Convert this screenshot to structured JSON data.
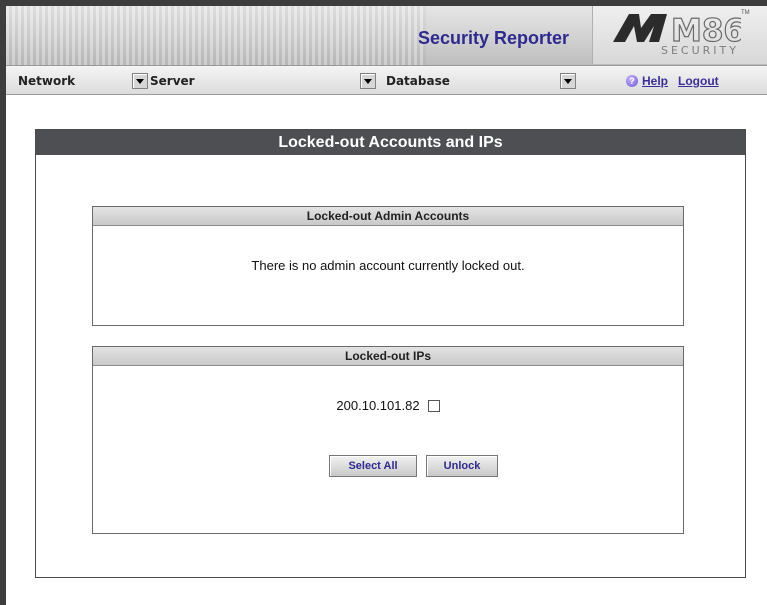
{
  "header": {
    "app_title": "Security Reporter",
    "logo_text": "M86",
    "logo_subtext": "SECURITY",
    "logo_tm": "TM"
  },
  "menubar": {
    "dropdowns": [
      {
        "label": "Network"
      },
      {
        "label": "Server"
      },
      {
        "label": "Database"
      }
    ],
    "help_label": "Help",
    "logout_label": "Logout"
  },
  "main": {
    "title": "Locked-out Accounts and IPs",
    "admin_section": {
      "title": "Locked-out Admin Accounts",
      "message": "There is no admin account currently locked out."
    },
    "ip_section": {
      "title": "Locked-out IPs",
      "ips": [
        {
          "address": "200.10.101.82",
          "checked": false
        }
      ],
      "select_all_label": "Select All",
      "unlock_label": "Unlock"
    }
  },
  "colors": {
    "title_bar": "#4d4f52",
    "brand_text": "#2e2a8f",
    "link": "#3a2f9a"
  },
  "icons": {
    "help": "help-circle-icon",
    "dropdown": "chevron-down-icon"
  }
}
